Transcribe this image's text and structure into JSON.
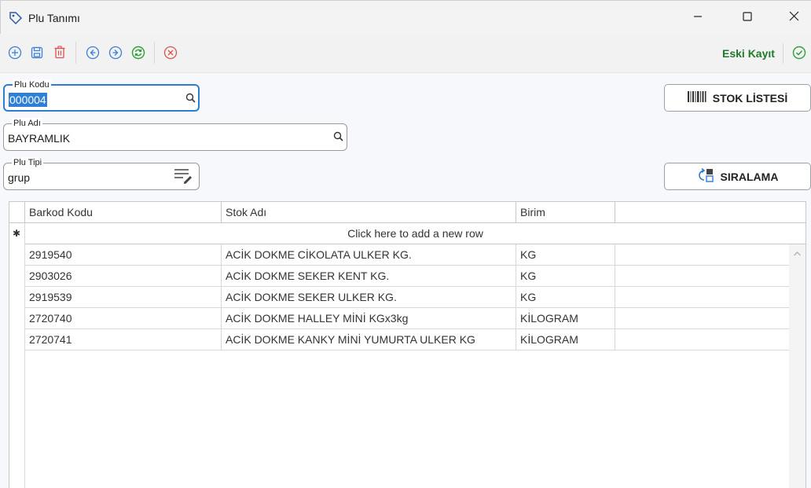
{
  "window": {
    "title": "Plu Tanımı",
    "app_icon": "tag-icon",
    "controls": [
      "minimize-icon",
      "maximize-icon",
      "close-icon"
    ]
  },
  "toolbar": {
    "buttons": [
      "add-icon",
      "save-icon",
      "delete-icon",
      "previous-icon",
      "next-icon",
      "refresh-icon",
      "cancel-icon"
    ],
    "status_label": "Eski Kayıt",
    "status_icon": "check-circle-icon",
    "status_color": "#1f7a2a"
  },
  "form": {
    "plu_code": {
      "label": "Plu Kodu",
      "value": "000004",
      "icon": "search-icon"
    },
    "plu_name": {
      "label": "Plu Adı",
      "value": "BAYRAMLIK",
      "icon": "search-icon"
    },
    "plu_type": {
      "label": "Plu Tipi",
      "value": "grup",
      "icon": "list-edit-icon"
    }
  },
  "buttons": {
    "stock_list": {
      "label": "STOK LİSTESİ",
      "icon": "barcode-icon"
    },
    "sort": {
      "label": "SIRALAMA",
      "icon": "reorder-icon"
    }
  },
  "grid": {
    "columns": [
      "Barkod Kodu",
      "Stok Adı",
      "Birim",
      ""
    ],
    "new_row_text": "Click here to add a new row",
    "new_row_marker": "✱",
    "rows": [
      {
        "barcode": "2919540",
        "name": "ACİK DOKME CİKOLATA ULKER KG.",
        "unit": "KG"
      },
      {
        "barcode": "2903026",
        "name": "ACİK DOKME SEKER KENT KG.",
        "unit": "KG"
      },
      {
        "barcode": "2919539",
        "name": "ACİK DOKME SEKER ULKER KG.",
        "unit": "KG"
      },
      {
        "barcode": "2720740",
        "name": "ACİK DOKME HALLEY MİNİ KGx3kg",
        "unit": "KİLOGRAM"
      },
      {
        "barcode": "2720741",
        "name": "ACİK DOKME KANKY MİNİ YUMURTA ULKER KG",
        "unit": "KİLOGRAM"
      }
    ]
  },
  "colors": {
    "accent": "#2d7dd2",
    "toolbar_icon_blue": "#3b7fd4",
    "delete_red": "#d9534f",
    "refresh_green": "#2e9e3a"
  }
}
